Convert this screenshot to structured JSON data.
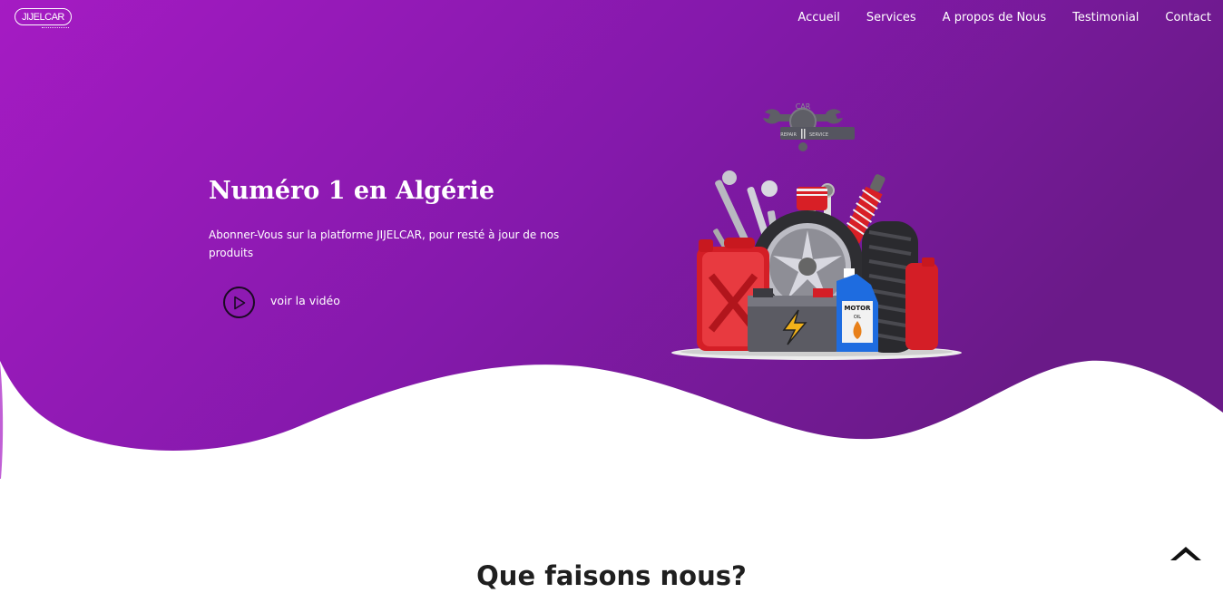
{
  "brand": {
    "logo_text": "JIJELCAR"
  },
  "nav": {
    "items": [
      {
        "label": "Accueil"
      },
      {
        "label": "Services"
      },
      {
        "label": "A propos de Nous"
      },
      {
        "label": "Testimonial"
      },
      {
        "label": "Contact"
      }
    ]
  },
  "hero": {
    "title": "Numéro 1 en Algérie",
    "subtitle": "Abonner-Vous sur la platforme JIJELCAR, pour resté à jour de nos produits",
    "video_label": "voir la vidéo",
    "illustration": {
      "badge_top": "CAR",
      "badge_left": "REPAIR",
      "badge_right": "SERVICE",
      "bottle_label": "MOTOR",
      "bottle_sub": "OIL"
    }
  },
  "section": {
    "title": "Que faisons nous?"
  },
  "colors": {
    "gradient_start": "#a51ec2",
    "gradient_end": "#6a1a89",
    "text_white": "#ffffff"
  },
  "icons": {
    "play": "play-icon",
    "scroll_top": "chevron-up-icon"
  }
}
